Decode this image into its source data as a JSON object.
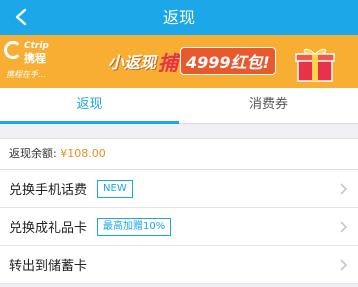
{
  "navbar": {
    "title": "返现"
  },
  "banner": {
    "brand_en": "Ctrip",
    "brand_cn": "携程",
    "slogan": "携程在手…",
    "promo_part1": "小返现",
    "promo_part2": "捕",
    "promo_part3": "4999红包!"
  },
  "tabs": [
    {
      "label": "返现",
      "active": true
    },
    {
      "label": "消费券",
      "active": false
    }
  ],
  "balance": {
    "label": "返现余额:",
    "amount": "¥108.00"
  },
  "list": [
    {
      "label": "兑换手机话费",
      "tag": "NEW"
    },
    {
      "label": "兑换成礼品卡",
      "tag": "最高加赠10%"
    },
    {
      "label": "转出到储蓄卡",
      "tag": ""
    }
  ],
  "colors": {
    "accent": "#1ba7e8",
    "banner": "#f7ae33",
    "amount": "#f08c1f"
  }
}
